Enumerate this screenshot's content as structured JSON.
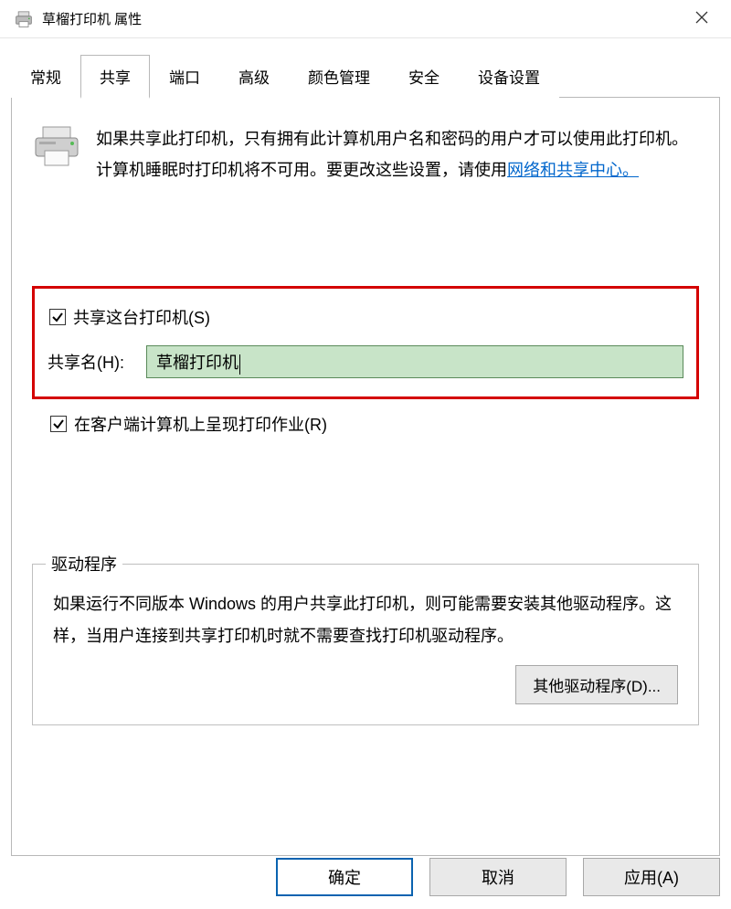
{
  "window": {
    "title": "草榴打印机 属性"
  },
  "tabs": [
    {
      "label": "常规"
    },
    {
      "label": "共享",
      "active": true
    },
    {
      "label": "端口"
    },
    {
      "label": "高级"
    },
    {
      "label": "颜色管理"
    },
    {
      "label": "安全"
    },
    {
      "label": "设备设置"
    }
  ],
  "description": {
    "before_link": "如果共享此打印机，只有拥有此计算机用户名和密码的用户才可以使用此打印机。计算机睡眠时打印机将不可用。要更改这些设置，请使用",
    "link_text": "网络和共享中心。"
  },
  "sharing": {
    "share_this_printer_label": "共享这台打印机(S)",
    "share_name_label": "共享名(H):",
    "share_name_value": "草榴打印机",
    "render_on_client_label": "在客户端计算机上呈现打印作业(R)"
  },
  "drivers": {
    "legend": "驱动程序",
    "text": "如果运行不同版本 Windows 的用户共享此打印机，则可能需要安装其他驱动程序。这样，当用户连接到共享打印机时就不需要查找打印机驱动程序。",
    "button_label": "其他驱动程序(D)..."
  },
  "buttons": {
    "ok": "确定",
    "cancel": "取消",
    "apply": "应用(A)"
  }
}
